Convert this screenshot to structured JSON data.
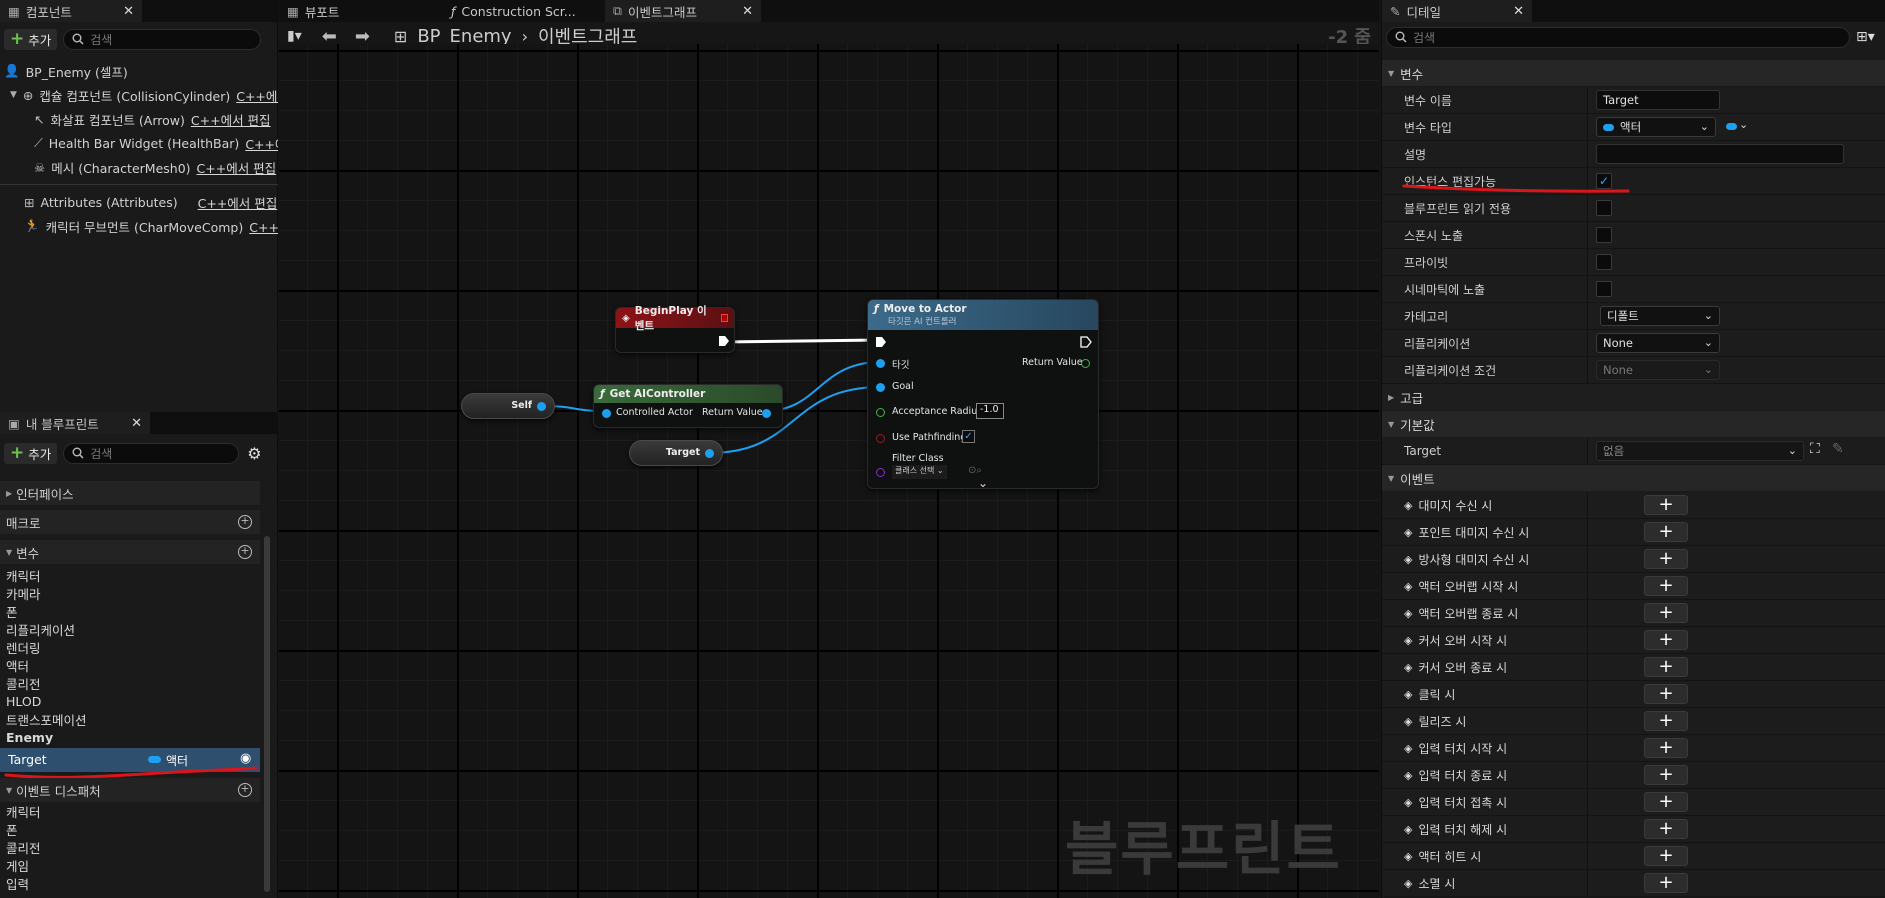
{
  "left_panel": {
    "components_tab": "컴포넌트",
    "add_label": "추가",
    "search_placeholder": "검색",
    "tree": [
      {
        "label": "BP_Enemy (셀프)",
        "cpp": ""
      },
      {
        "label": "캡슐 컴포넌트 (CollisionCylinder)",
        "cpp": "C++에..."
      },
      {
        "label": "화살표 컴포넌트 (Arrow)",
        "cpp": "C++에서 편집"
      },
      {
        "label": "Health Bar Widget (HealthBar)",
        "cpp": "C++에..."
      },
      {
        "label": "메시 (CharacterMesh0)",
        "cpp": "C++에서 편집"
      },
      {
        "label": "Attributes (Attributes)",
        "cpp": "C++에서 편집"
      },
      {
        "label": "캐릭터 무브먼트 (CharMoveComp)",
        "cpp": "C++에"
      }
    ],
    "my_blueprint_tab": "내 블루프린트",
    "sections": {
      "interface": "인터페이스",
      "macro": "매크로",
      "variables": "변수",
      "event_dispatcher": "이벤트 디스패처"
    },
    "variable_categories": [
      "캐릭터",
      "카메라",
      "폰",
      "리플리케이션",
      "렌더링",
      "액터",
      "콜리전",
      "HLOD",
      "트랜스포메이션",
      "Enemy"
    ],
    "selected_variable": {
      "name": "Target",
      "type": "액터"
    },
    "dispatcher_categories": [
      "캐릭터",
      "폰",
      "콜리전",
      "게임",
      "입력"
    ]
  },
  "center": {
    "tabs": [
      "뷰포트",
      "Construction Scr...",
      "이벤트그래프"
    ],
    "breadcrumb": {
      "root": "BP_Enemy",
      "current": "이벤트그래프"
    },
    "zoom": "-2 줌",
    "watermark": "블루프린트",
    "nodes": {
      "begin_play": {
        "title": "BeginPlay 이벤트"
      },
      "move_to_actor": {
        "title": "Move to Actor",
        "subtitle": "타깃은 AI 컨트롤러",
        "pins": {
          "target": "타깃",
          "goal": "Goal",
          "acceptance": "Acceptance Radius",
          "acceptance_value": "-1.0",
          "use_path": "Use Pathfinding",
          "filter": "Filter Class",
          "filter_select": "클래스 선택",
          "return": "Return Value"
        }
      },
      "get_ai_controller": {
        "title": "Get AIController",
        "in_pin": "Controlled Actor",
        "out_pin": "Return Value"
      },
      "self": {
        "label": "Self"
      },
      "target_var": {
        "label": "Target"
      }
    }
  },
  "details": {
    "tab": "디테일",
    "search_placeholder": "검색",
    "variable_section": "변수",
    "rows": {
      "var_name": {
        "label": "변수 이름",
        "value": "Target"
      },
      "var_type": {
        "label": "변수 타입",
        "value": "액터"
      },
      "description": {
        "label": "설명",
        "value": ""
      },
      "instance_editable": {
        "label": "인스턴스 편집가능"
      },
      "bp_readonly": {
        "label": "블루프린트 읽기 전용"
      },
      "expose_spawn": {
        "label": "스폰시 노출"
      },
      "private": {
        "label": "프라이빗"
      },
      "expose_cinematic": {
        "label": "시네마틱에 노출"
      },
      "category": {
        "label": "카테고리",
        "value": "디폴트"
      },
      "replication": {
        "label": "리플리케이션",
        "value": "None"
      },
      "replication_cond": {
        "label": "리플리케이션 조건",
        "value": "None"
      }
    },
    "advanced_section": "고급",
    "default_section": "기본값",
    "default_target": {
      "label": "Target",
      "value": "없음"
    },
    "events_section": "이벤트",
    "events": [
      "대미지 수신 시",
      "포인트 대미지 수신 시",
      "방사형 대미지 수신 시",
      "액터 오버랩 시작 시",
      "액터 오버랩 종료 시",
      "커서 오버 시작 시",
      "커서 오버 종료 시",
      "클릭 시",
      "릴리즈 시",
      "입력 터치 시작 시",
      "입력 터치 종료 시",
      "입력 터치 접촉 시",
      "입력 터치 해제 시",
      "액터 히트 시",
      "소멸 시"
    ]
  },
  "colors": {
    "accent_blue": "#1ea0f0",
    "exec_white": "#ffffff",
    "annotation_red": "#d8161b",
    "event_red": "#8e1318",
    "func_green": "#3a6a3a",
    "func_blue": "#3c6a8a"
  }
}
